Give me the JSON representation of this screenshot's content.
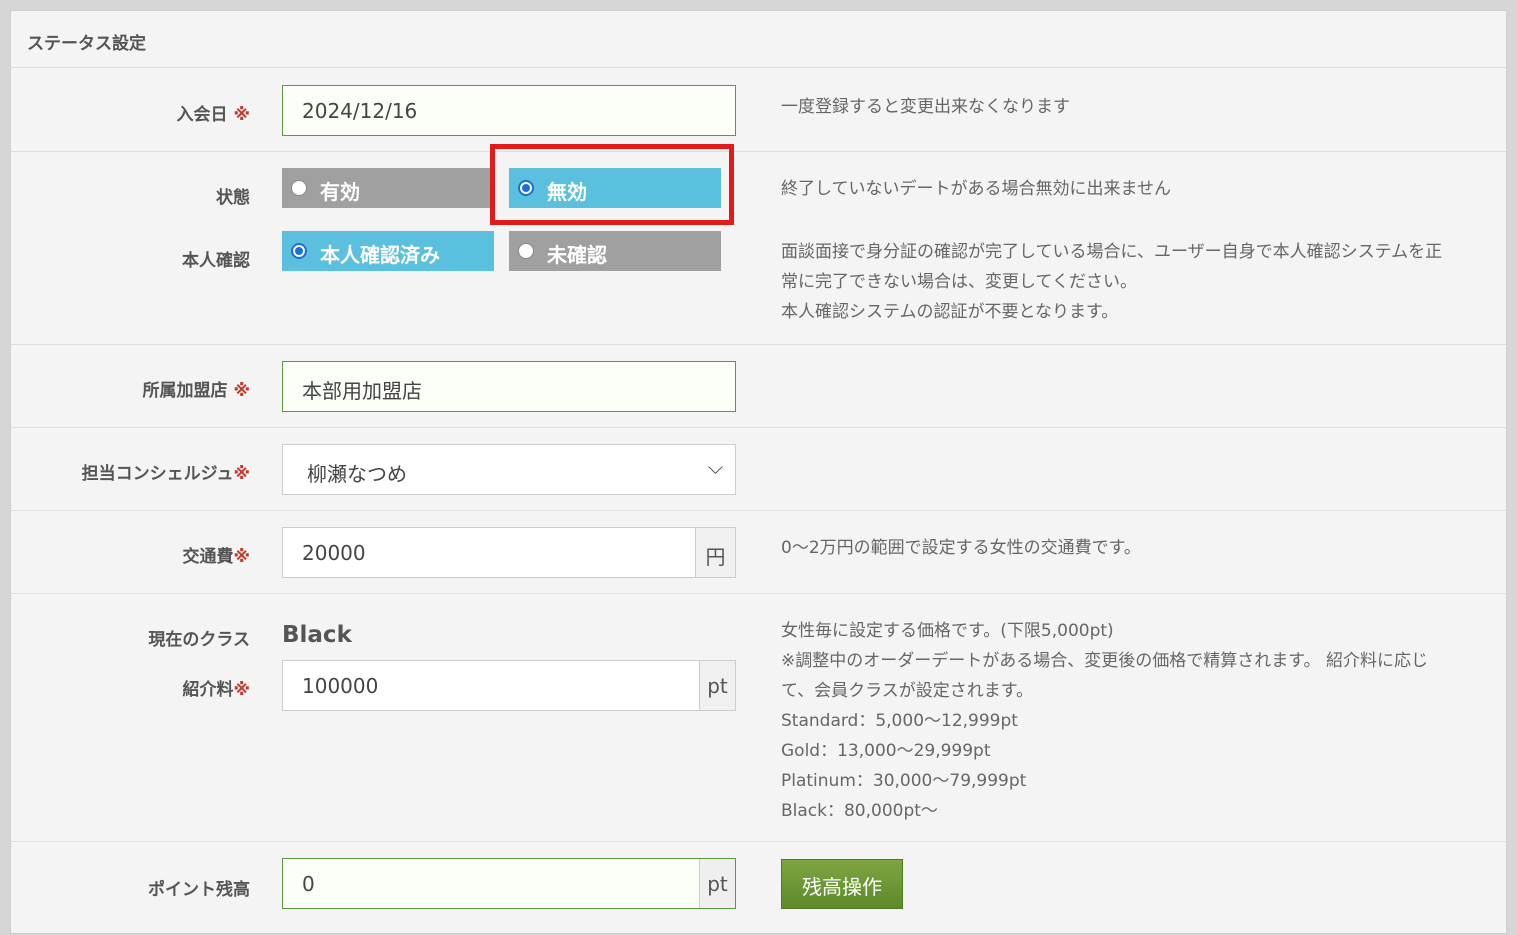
{
  "section_title": "ステータス設定",
  "required_mark": "※",
  "join_date": {
    "label": "入会日",
    "value": "2024/12/16",
    "help": "一度登録すると変更出来なくなります"
  },
  "status": {
    "label": "状態",
    "options": [
      "有効",
      "無効"
    ],
    "selected": "無効",
    "help": "終了していないデートがある場合無効に出来ません"
  },
  "identity": {
    "label": "本人確認",
    "options": [
      "本人確認済み",
      "未確認"
    ],
    "selected": "本人確認済み",
    "help": [
      "面談面接で身分証の確認が完了している場合に、ユーザー自身で本人確認システムを正",
      "常に完了できない場合は、変更してください。",
      "本人確認システムの認証が不要となります。"
    ]
  },
  "store": {
    "label": "所属加盟店",
    "value": "本部用加盟店"
  },
  "concierge": {
    "label": "担当コンシェルジュ",
    "selected": "柳瀬なつめ"
  },
  "transport": {
    "label": "交通費",
    "value": "20000",
    "unit": "円",
    "help": "0～2万円の範囲で設定する女性の交通費です。"
  },
  "class": {
    "label": "現在のクラス",
    "value": "Black"
  },
  "fee": {
    "label": "紹介料",
    "value": "100000",
    "unit": "pt",
    "help": [
      "女性毎に設定する価格です。(下限5,000pt)",
      "※調整中のオーダーデートがある場合、変更後の価格で精算されます。 紹介料に応じ",
      "て、会員クラスが設定されます。",
      "Standard：5,000～12,999pt",
      "Gold：13,000～29,999pt",
      "Platinum：30,000～79,999pt",
      "Black：80,000pt～"
    ]
  },
  "points": {
    "label": "ポイント残高",
    "value": "0",
    "unit": "pt",
    "button": "残高操作"
  },
  "colors": {
    "radio_selected": "#5bc0de",
    "radio_unselected": "#a0a0a0",
    "required": "#c0392b",
    "highlight": "#e01b1b",
    "button": "#6b9434"
  }
}
